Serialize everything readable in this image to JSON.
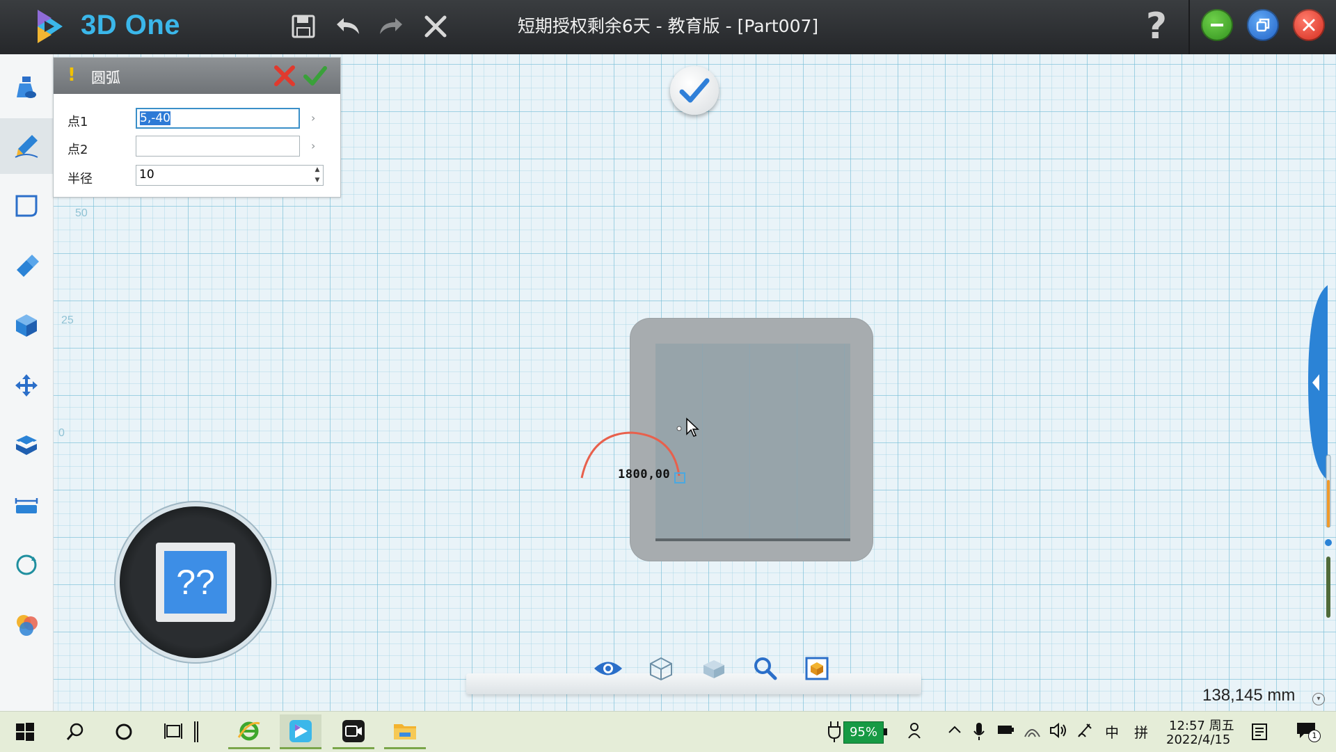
{
  "app": {
    "name": "3D One",
    "doc_title": "短期授权剩余6天 - 教育版 - [Part007]"
  },
  "colors": {
    "accent": "#3bb7ea",
    "arc": "#e8604c",
    "cancel": "#e03a2e",
    "ok": "#3aa13a"
  },
  "titlebar_icons": [
    "save-icon",
    "undo-icon",
    "redo-icon",
    "close-x-icon",
    "help-icon",
    "minimize-icon",
    "restore-icon",
    "close-icon"
  ],
  "help_glyph": "?",
  "left_toolbar": {
    "items": [
      "primitive-shapes-icon",
      "sketch-pencil-icon",
      "curve-frame-icon",
      "feature-tool-icon",
      "special-function-icon",
      "move-icon",
      "combine-icon",
      "distance-measure-icon",
      "pattern-icon",
      "material-render-icon"
    ]
  },
  "arc_panel": {
    "warn_glyph": "!",
    "title": "圆弧",
    "fields": [
      {
        "label": "点1",
        "value": "5,-40"
      },
      {
        "label": "点2",
        "value": ""
      },
      {
        "label": "半径",
        "value": "10"
      }
    ]
  },
  "viewport": {
    "axis_labels": [
      "50",
      "25",
      "0"
    ],
    "dimension_text": "1800,00",
    "view_cube_label": "??"
  },
  "bottom_tools": [
    "eye-icon",
    "wireframe-cube-icon",
    "shaded-cube-icon",
    "zoom-icon",
    "fit-view-icon"
  ],
  "units_readout": "138,145 mm",
  "taskbar": {
    "apps": [
      "start-icon",
      "search-icon",
      "cortana-icon",
      "task-view-icon",
      "pen-icon",
      "ie-browser-icon",
      "3d-one-icon",
      "camera-app-icon",
      "file-explorer-icon"
    ],
    "battery": "95%",
    "ime_lang": "中",
    "ime_mode": "拼",
    "time": "12:57 周五",
    "date": "2022/4/15",
    "notification_count": "1"
  }
}
